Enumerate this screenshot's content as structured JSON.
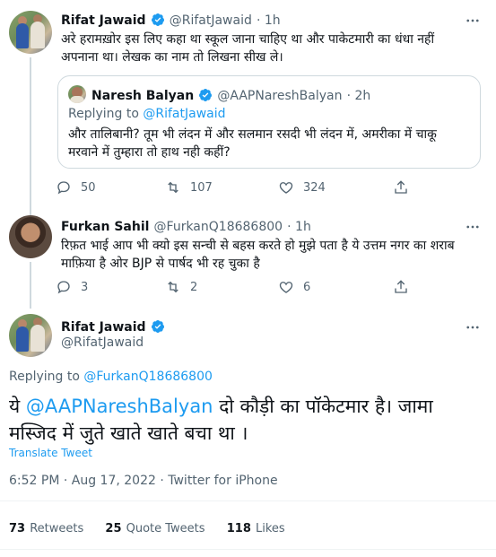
{
  "tweet1": {
    "name": "Rifat Jawaid",
    "handle": "@RifatJawaid",
    "time": "1h",
    "text": "अरे हरामख़ोर इस लिए कहा था स्कूल जाना चाहिए था और पाकेटमारी का धंधा नहीं अपनाना था। लेखक का नाम तो लिखना सीख ले।",
    "quote": {
      "name": "Naresh Balyan",
      "handle": "@AAPNareshBalyan",
      "time": "2h",
      "replying_prefix": "Replying to",
      "replying_to": "@RifatJawaid",
      "text": "और तालिबानी? तूम भी लंदन में और सलमान रसदी भी लंदन में, अमरीका में चाकू मरवाने में तुम्हारा तो हाथ नही कहीं?"
    },
    "replies": "50",
    "retweets": "107",
    "likes": "324"
  },
  "tweet2": {
    "name": "Furkan Sahil",
    "handle": "@FurkanQ18686800",
    "time": "1h",
    "text": "रिफ़त भाई आप भी क्यो इस सन्ची से बहस करते हो मुझे पता है ये उत्तम नगर का शराब माफ़िया है ओर BJP से पार्षद भी रह चुका है",
    "replies": "3",
    "retweets": "2",
    "likes": "6"
  },
  "main": {
    "name": "Rifat Jawaid",
    "handle": "@RifatJawaid",
    "replying_prefix": "Replying to",
    "replying_to": "@FurkanQ18686800",
    "text_prefix": "ये",
    "mention": "@AAPNareshBalyan",
    "text_rest": "दो कौड़ी का पॉकेटमार है। जामा मस्जिद में जुते खाते खाते बचा था ।",
    "translate": "Translate Tweet",
    "timestamp": "6:52 PM · Aug 17, 2022 · Twitter for iPhone",
    "retweets_count": "73",
    "retweets_label": "Retweets",
    "quotes_count": "25",
    "quotes_label": "Quote Tweets",
    "likes_count": "118",
    "likes_label": "Likes"
  },
  "icons": {
    "reply": "reply-icon",
    "retweet": "retweet-icon",
    "like": "heart-icon",
    "share": "share-icon",
    "more": "more-icon",
    "verified": "verified-badge-icon"
  },
  "colors": {
    "accent": "#1d9bf0",
    "muted": "#536471",
    "line": "#cfd9de"
  }
}
